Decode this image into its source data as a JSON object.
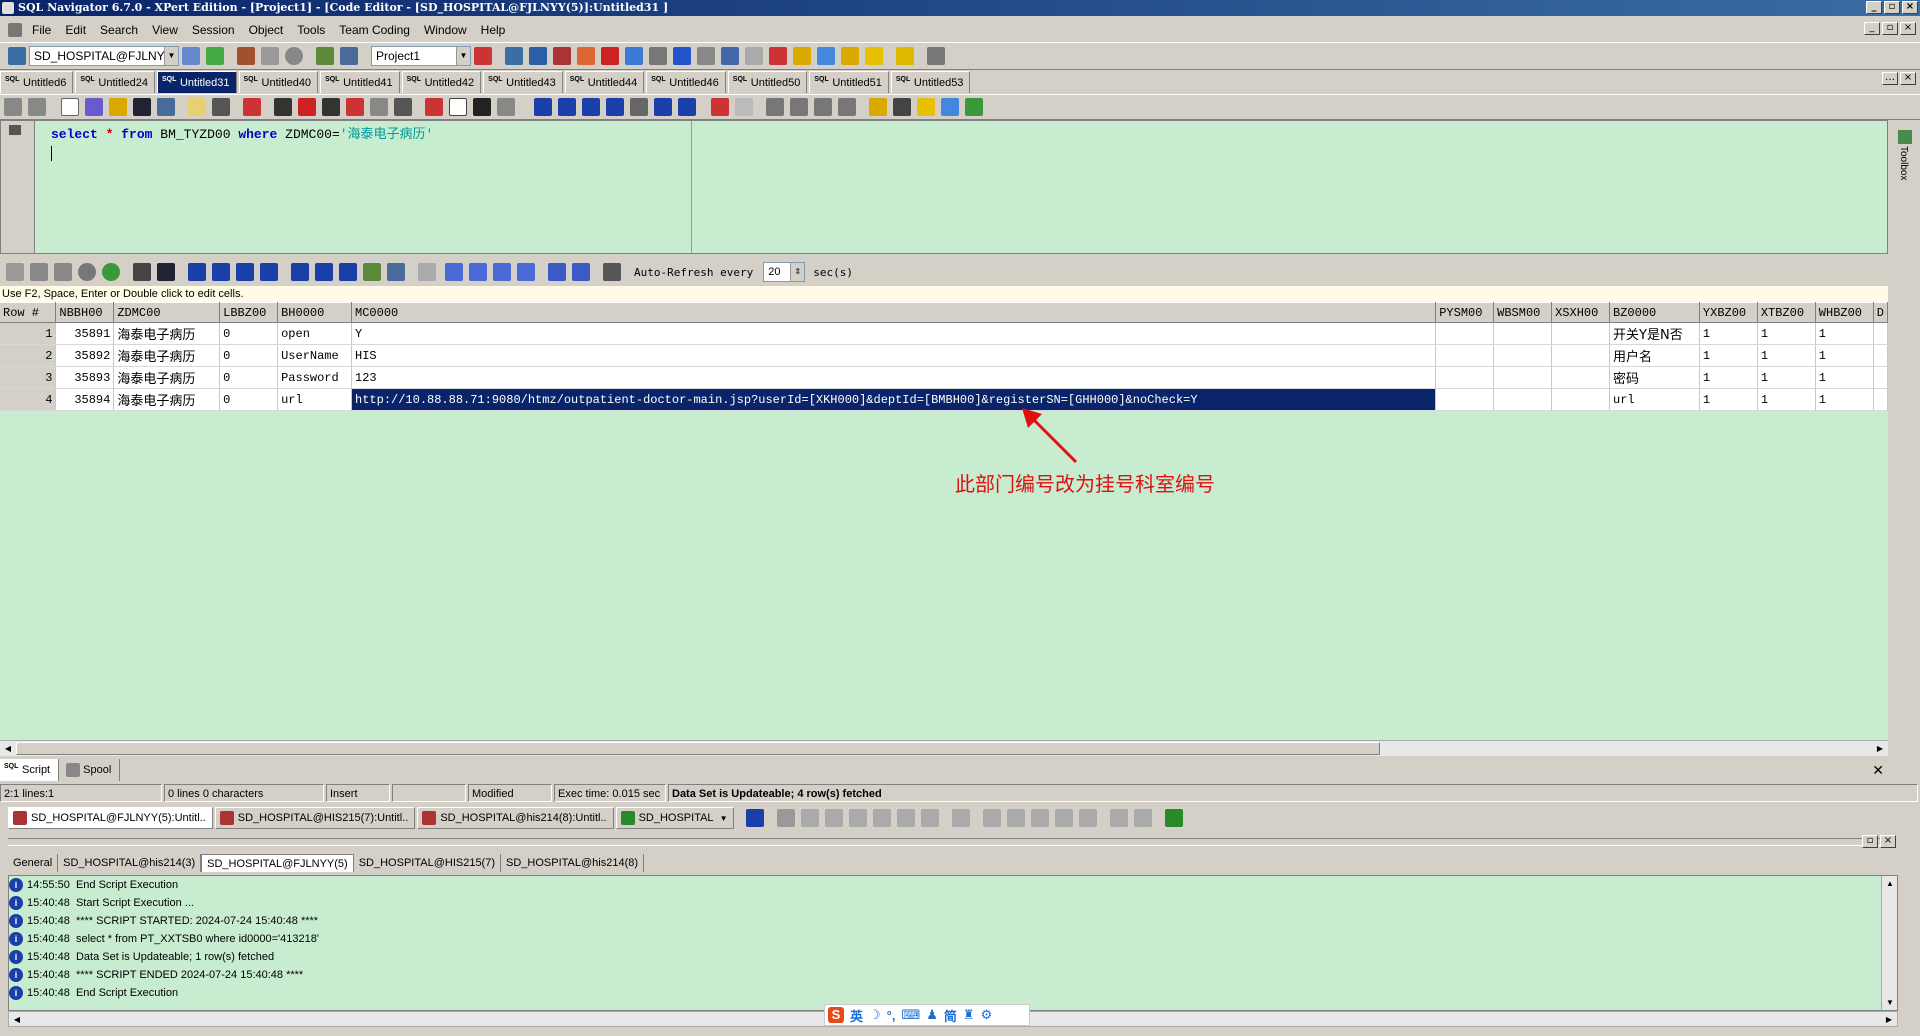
{
  "window": {
    "title": "SQL Navigator 6.7.0 - XPert Edition - [Project1] - [Code Editor - [SD_HOSPITAL@FJLNYY(5)]:Untitled31 ]"
  },
  "menu": [
    "File",
    "Edit",
    "Search",
    "View",
    "Session",
    "Object",
    "Tools",
    "Team Coding",
    "Window",
    "Help"
  ],
  "toolbar": {
    "connection": "SD_HOSPITAL@FJLNYY(",
    "project": "Project1"
  },
  "doc_tabs": [
    "Untitled6",
    "Untitled24",
    "Untitled31",
    "Untitled40",
    "Untitled41",
    "Untitled42",
    "Untitled43",
    "Untitled44",
    "Untitled46",
    "Untitled50",
    "Untitled51",
    "Untitled53"
  ],
  "active_doc_tab": "Untitled31",
  "editor": {
    "kw_select": "select",
    "star": "*",
    "kw_from": "from",
    "table": "BM_TYZD00",
    "kw_where": "where",
    "col": "ZDMC00=",
    "value": "'海泰电子病历'"
  },
  "toolbox_label": "Toolbox",
  "grid_toolbar": {
    "auto_refresh": "Auto-Refresh every",
    "interval": "20",
    "unit": "sec(s)"
  },
  "hint": "Use F2, Space, Enter or Double click to edit cells.",
  "grid": {
    "columns": [
      "Row #",
      "NBBH00",
      "ZDMC00",
      "LBBZ00",
      "BH0000",
      "MC0000",
      "PYSM00",
      "WBSM00",
      "XSXH00",
      "BZ0000",
      "YXBZ00",
      "XTBZ00",
      "WHBZ00",
      "D"
    ],
    "rows": [
      [
        "1",
        "35891",
        "海泰电子病历",
        "0",
        "open",
        "Y",
        "",
        "",
        "",
        "开关Y是N否",
        "1",
        "1",
        "1"
      ],
      [
        "2",
        "35892",
        "海泰电子病历",
        "0",
        "UserName",
        "HIS",
        "",
        "",
        "",
        "用户名",
        "1",
        "1",
        "1"
      ],
      [
        "3",
        "35893",
        "海泰电子病历",
        "0",
        "Password",
        "123",
        "",
        "",
        "",
        "密码",
        "1",
        "1",
        "1"
      ],
      [
        "4",
        "35894",
        "海泰电子病历",
        "0",
        "url",
        "http://10.88.88.71:9080/htmz/outpatient-doctor-main.jsp?userId=[XKH000]&deptId=[BMBH00]&registerSN=[GHH000]&noCheck=Y",
        "",
        "",
        "",
        "url",
        "1",
        "1",
        "1"
      ]
    ]
  },
  "annotation": "此部门编号改为挂号科室编号",
  "output_tabs": [
    "Script",
    "Spool"
  ],
  "status": {
    "pos": "2:1 lines:1",
    "chars": "0 lines 0 characters",
    "mode": "Insert",
    "blank": "",
    "modified": "Modified",
    "exec": "Exec time: 0.015 sec",
    "message": "Data Set is Updateable; 4 row(s) fetched"
  },
  "conn_tabs": [
    "SD_HOSPITAL@FJLNYY(5):Untitl..",
    "SD_HOSPITAL@HIS215(7):Untitl..",
    "SD_HOSPITAL@his214(8):Untitl..",
    "SD_HOSPITAL"
  ],
  "output_head_tabs": [
    "General",
    "SD_HOSPITAL@his214(3)",
    "SD_HOSPITAL@FJLNYY(5)",
    "SD_HOSPITAL@HIS215(7)",
    "SD_HOSPITAL@his214(8)"
  ],
  "log": [
    {
      "time": "14:55:50",
      "msg": "End Script Execution"
    },
    {
      "time": "15:40:48",
      "msg": "Start Script Execution ..."
    },
    {
      "time": "15:40:48",
      "msg": "**** SCRIPT STARTED: 2024-07-24 15:40:48 ****"
    },
    {
      "time": "15:40:48",
      "msg": "select * from PT_XXTSB0 where id0000='413218'"
    },
    {
      "time": "15:40:48",
      "msg": "Data Set is Updateable; 1 row(s) fetched"
    },
    {
      "time": "15:40:48",
      "msg": "**** SCRIPT ENDED 2024-07-24 15:40:48 ****"
    },
    {
      "time": "15:40:48",
      "msg": "End Script Execution"
    }
  ],
  "ime": [
    "英",
    "简"
  ]
}
